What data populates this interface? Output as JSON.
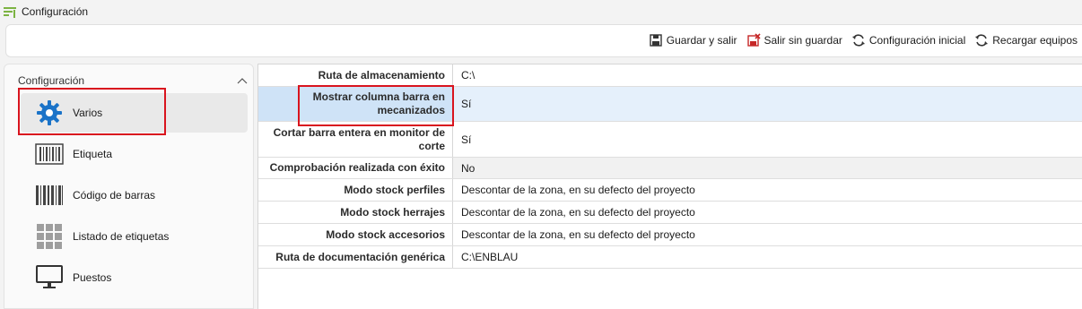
{
  "window": {
    "title": "Configuración"
  },
  "toolbar": {
    "save_exit": "Guardar y salir",
    "exit_nosave": "Salir sin guardar",
    "initial_config": "Configuración inicial",
    "reload_equipment": "Recargar equipos"
  },
  "sidebar": {
    "header": "Configuración",
    "items": [
      {
        "label": "Varios",
        "icon": "gear-icon"
      },
      {
        "label": "Etiqueta",
        "icon": "label-icon"
      },
      {
        "label": "Código de barras",
        "icon": "barcode-icon"
      },
      {
        "label": "Listado de etiquetas",
        "icon": "label-list-icon"
      },
      {
        "label": "Puestos",
        "icon": "monitor-icon"
      }
    ]
  },
  "grid": {
    "rows": [
      {
        "label": "Ruta de almacenamiento",
        "value": "C:\\"
      },
      {
        "label": "Mostrar columna barra en mecanizados",
        "value": "Sí"
      },
      {
        "label": "Cortar barra entera en monitor de corte",
        "value": "Sí"
      },
      {
        "label": "Comprobación realizada con éxito",
        "value": "No"
      },
      {
        "label": "Modo stock perfiles",
        "value": "Descontar de la zona, en su defecto del proyecto"
      },
      {
        "label": "Modo stock herrajes",
        "value": "Descontar de la zona, en su defecto del proyecto"
      },
      {
        "label": "Modo stock accesorios",
        "value": "Descontar de la zona, en su defecto del proyecto"
      },
      {
        "label": "Ruta de documentación genérica",
        "value": "C:\\ENBLAU"
      }
    ]
  },
  "colors": {
    "accent": "#1a73c8",
    "highlight": "#d9141e",
    "selected_row": "#e5f0fb"
  }
}
